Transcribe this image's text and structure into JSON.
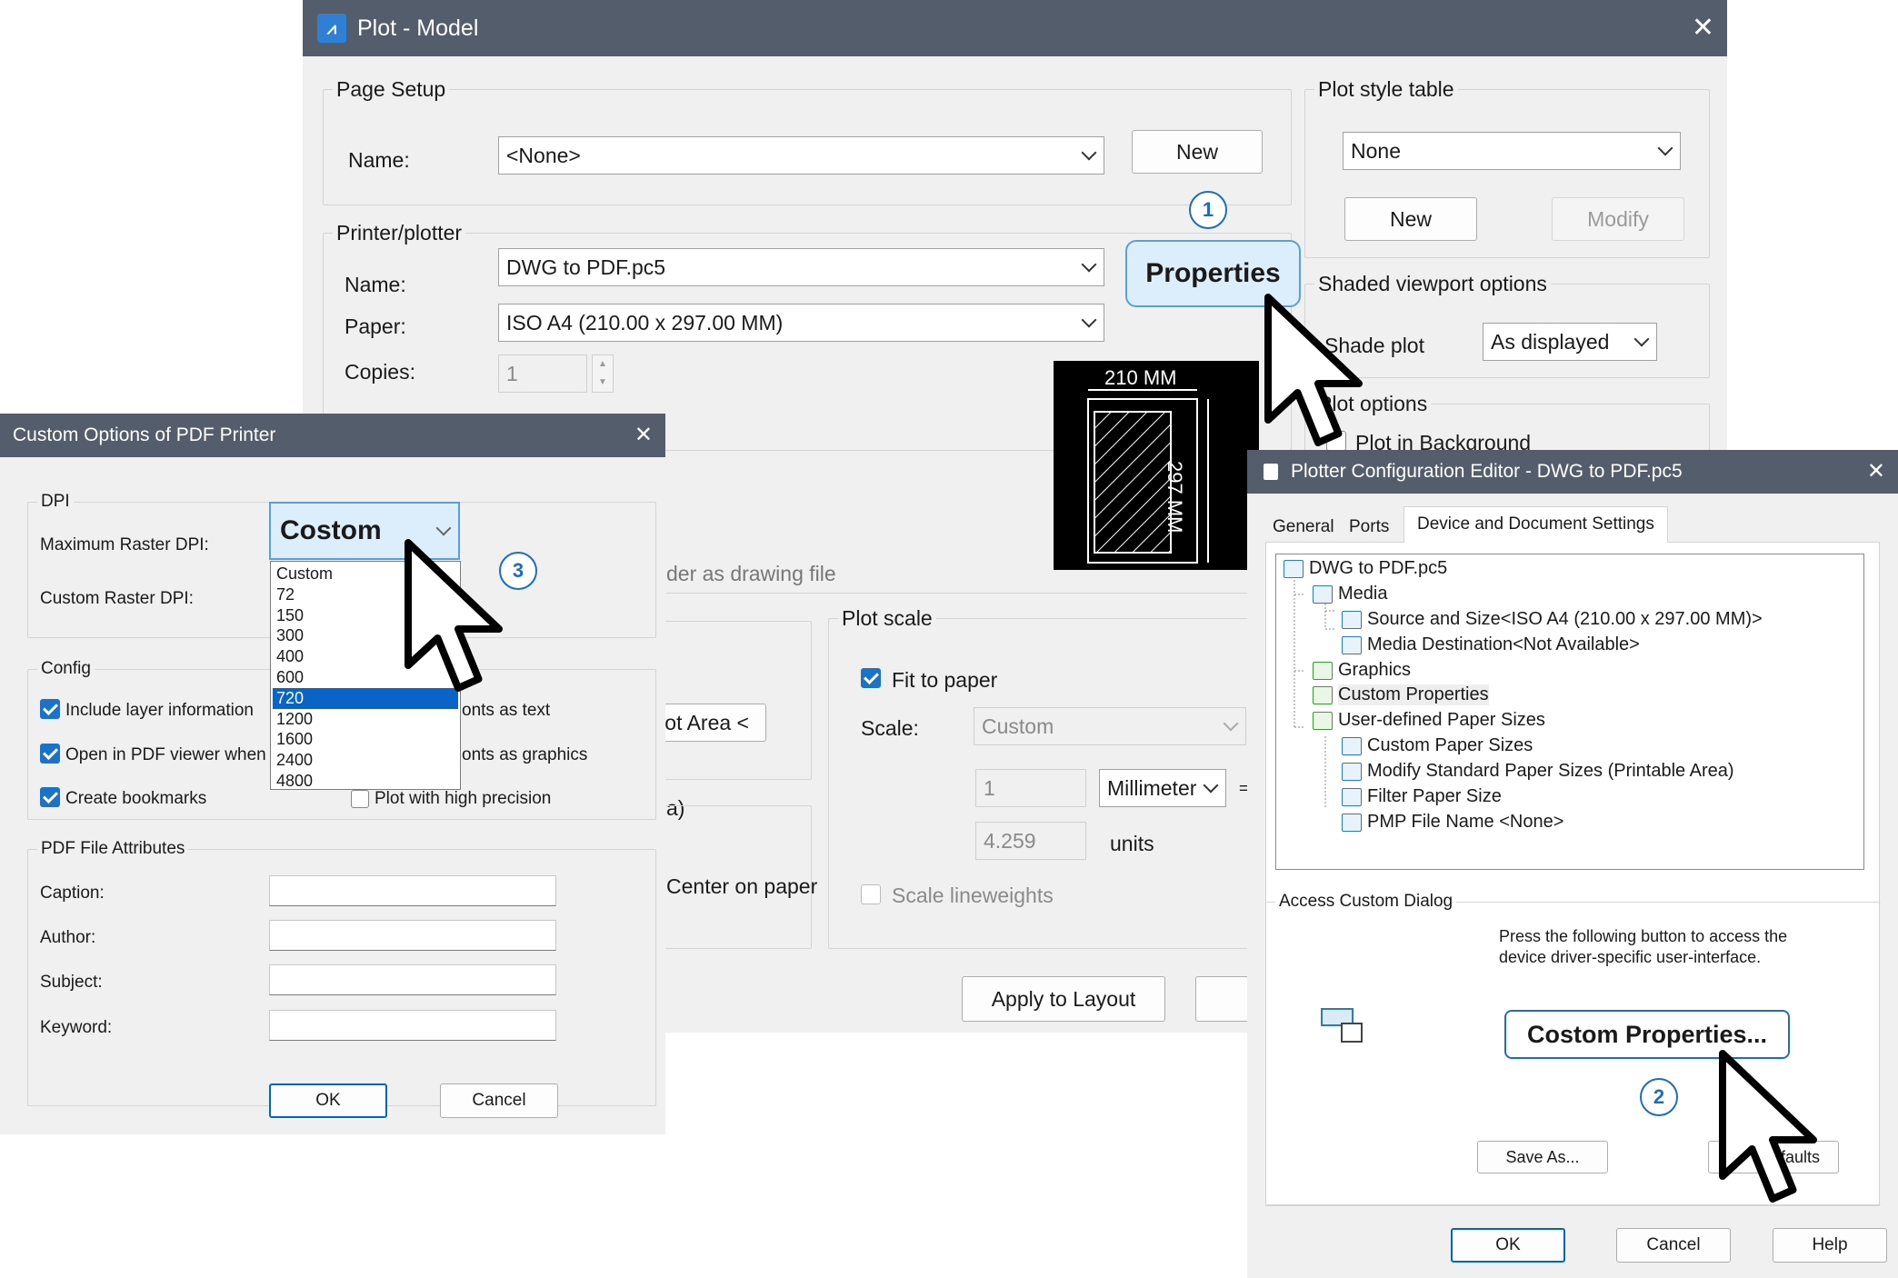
{
  "plot": {
    "title": "Plot - Model",
    "page_setup": {
      "group": "Page Setup",
      "name_label": "Name:",
      "name_value": "<None>",
      "new_button": "New"
    },
    "printer": {
      "group": "Printer/plotter",
      "name_label": "Name:",
      "name_value": "DWG to PDF.pc5",
      "paper_label": "Paper:",
      "paper_value": "ISO A4 (210.00 x 297.00 MM)",
      "copies_label": "Copies:",
      "copies_value": "1",
      "properties_button": "Properties",
      "preview_width": "210 MM",
      "preview_height": "297 MM"
    },
    "plot_style": {
      "group": "Plot style table",
      "value": "None",
      "new_button": "New",
      "modify_button": "Modify"
    },
    "shaded": {
      "group": "Shaded viewport options",
      "shade_label": "Shade plot",
      "shade_value": "As displayed"
    },
    "plot_options": {
      "group": "Plot options",
      "background_label": "Plot in Background"
    },
    "partial": {
      "drawing_file": "der as drawing file",
      "area_button": "ot Area <",
      "area_label": "a)",
      "center_label": "Center on paper"
    },
    "plot_scale": {
      "group": "Plot scale",
      "fit_label": "Fit to paper",
      "scale_label": "Scale:",
      "scale_value": "Custom",
      "value1": "1",
      "unit_value": "Millimeter",
      "equals": "=",
      "value2": "4.259",
      "units_label": "units",
      "lineweights_label": "Scale lineweights"
    },
    "apply_button": "Apply to Layout"
  },
  "custom": {
    "title": "Custom Options of PDF Printer",
    "dpi_group": "DPI",
    "max_label": "Maximum Raster DPI:",
    "custom_label": "Custom Raster DPI:",
    "dpi_value": "Costom",
    "dpi_options": [
      "Custom",
      "72",
      "150",
      "300",
      "400",
      "600",
      "720",
      "1200",
      "1600",
      "2400",
      "4800"
    ],
    "selected_option": "720",
    "config_group": "Config",
    "include_layer": "Include layer information",
    "open_viewer": "Open in PDF viewer when",
    "bookmarks": "Create bookmarks",
    "fonts_text": "onts as text",
    "fonts_graphics": "onts as graphics",
    "high_precision": "Plot with high precision",
    "attr_group": "PDF File Attributes",
    "caption_label": "Caption:",
    "author_label": "Author:",
    "subject_label": "Subject:",
    "keyword_label": "Keyword:",
    "ok_button": "OK",
    "cancel_button": "Cancel"
  },
  "pce": {
    "title": "Plotter Configuration Editor - DWG to PDF.pc5",
    "tabs": [
      "General",
      "Ports",
      "Device and Document Settings"
    ],
    "tree": [
      "DWG to PDF.pc5",
      "Media",
      "Source and Size<ISO A4 (210.00 x 297.00 MM)>",
      "Media Destination<Not Available>",
      "Graphics",
      "Custom Properties",
      "User-defined Paper Sizes",
      "Custom Paper Sizes",
      "Modify Standard Paper Sizes (Printable Area)",
      "Filter Paper Size",
      "PMP File Name <None>"
    ],
    "access_group": "Access Custom Dialog",
    "access_text": "Press the following button to access the device driver-specific user-interface.",
    "custom_button": "Costom Properties...",
    "save_button": "Save As...",
    "defaults_button": "efaults",
    "ok_button": "OK",
    "cancel_button": "Cancel",
    "help_button": "Help"
  },
  "badges": [
    "1",
    "2",
    "3"
  ]
}
